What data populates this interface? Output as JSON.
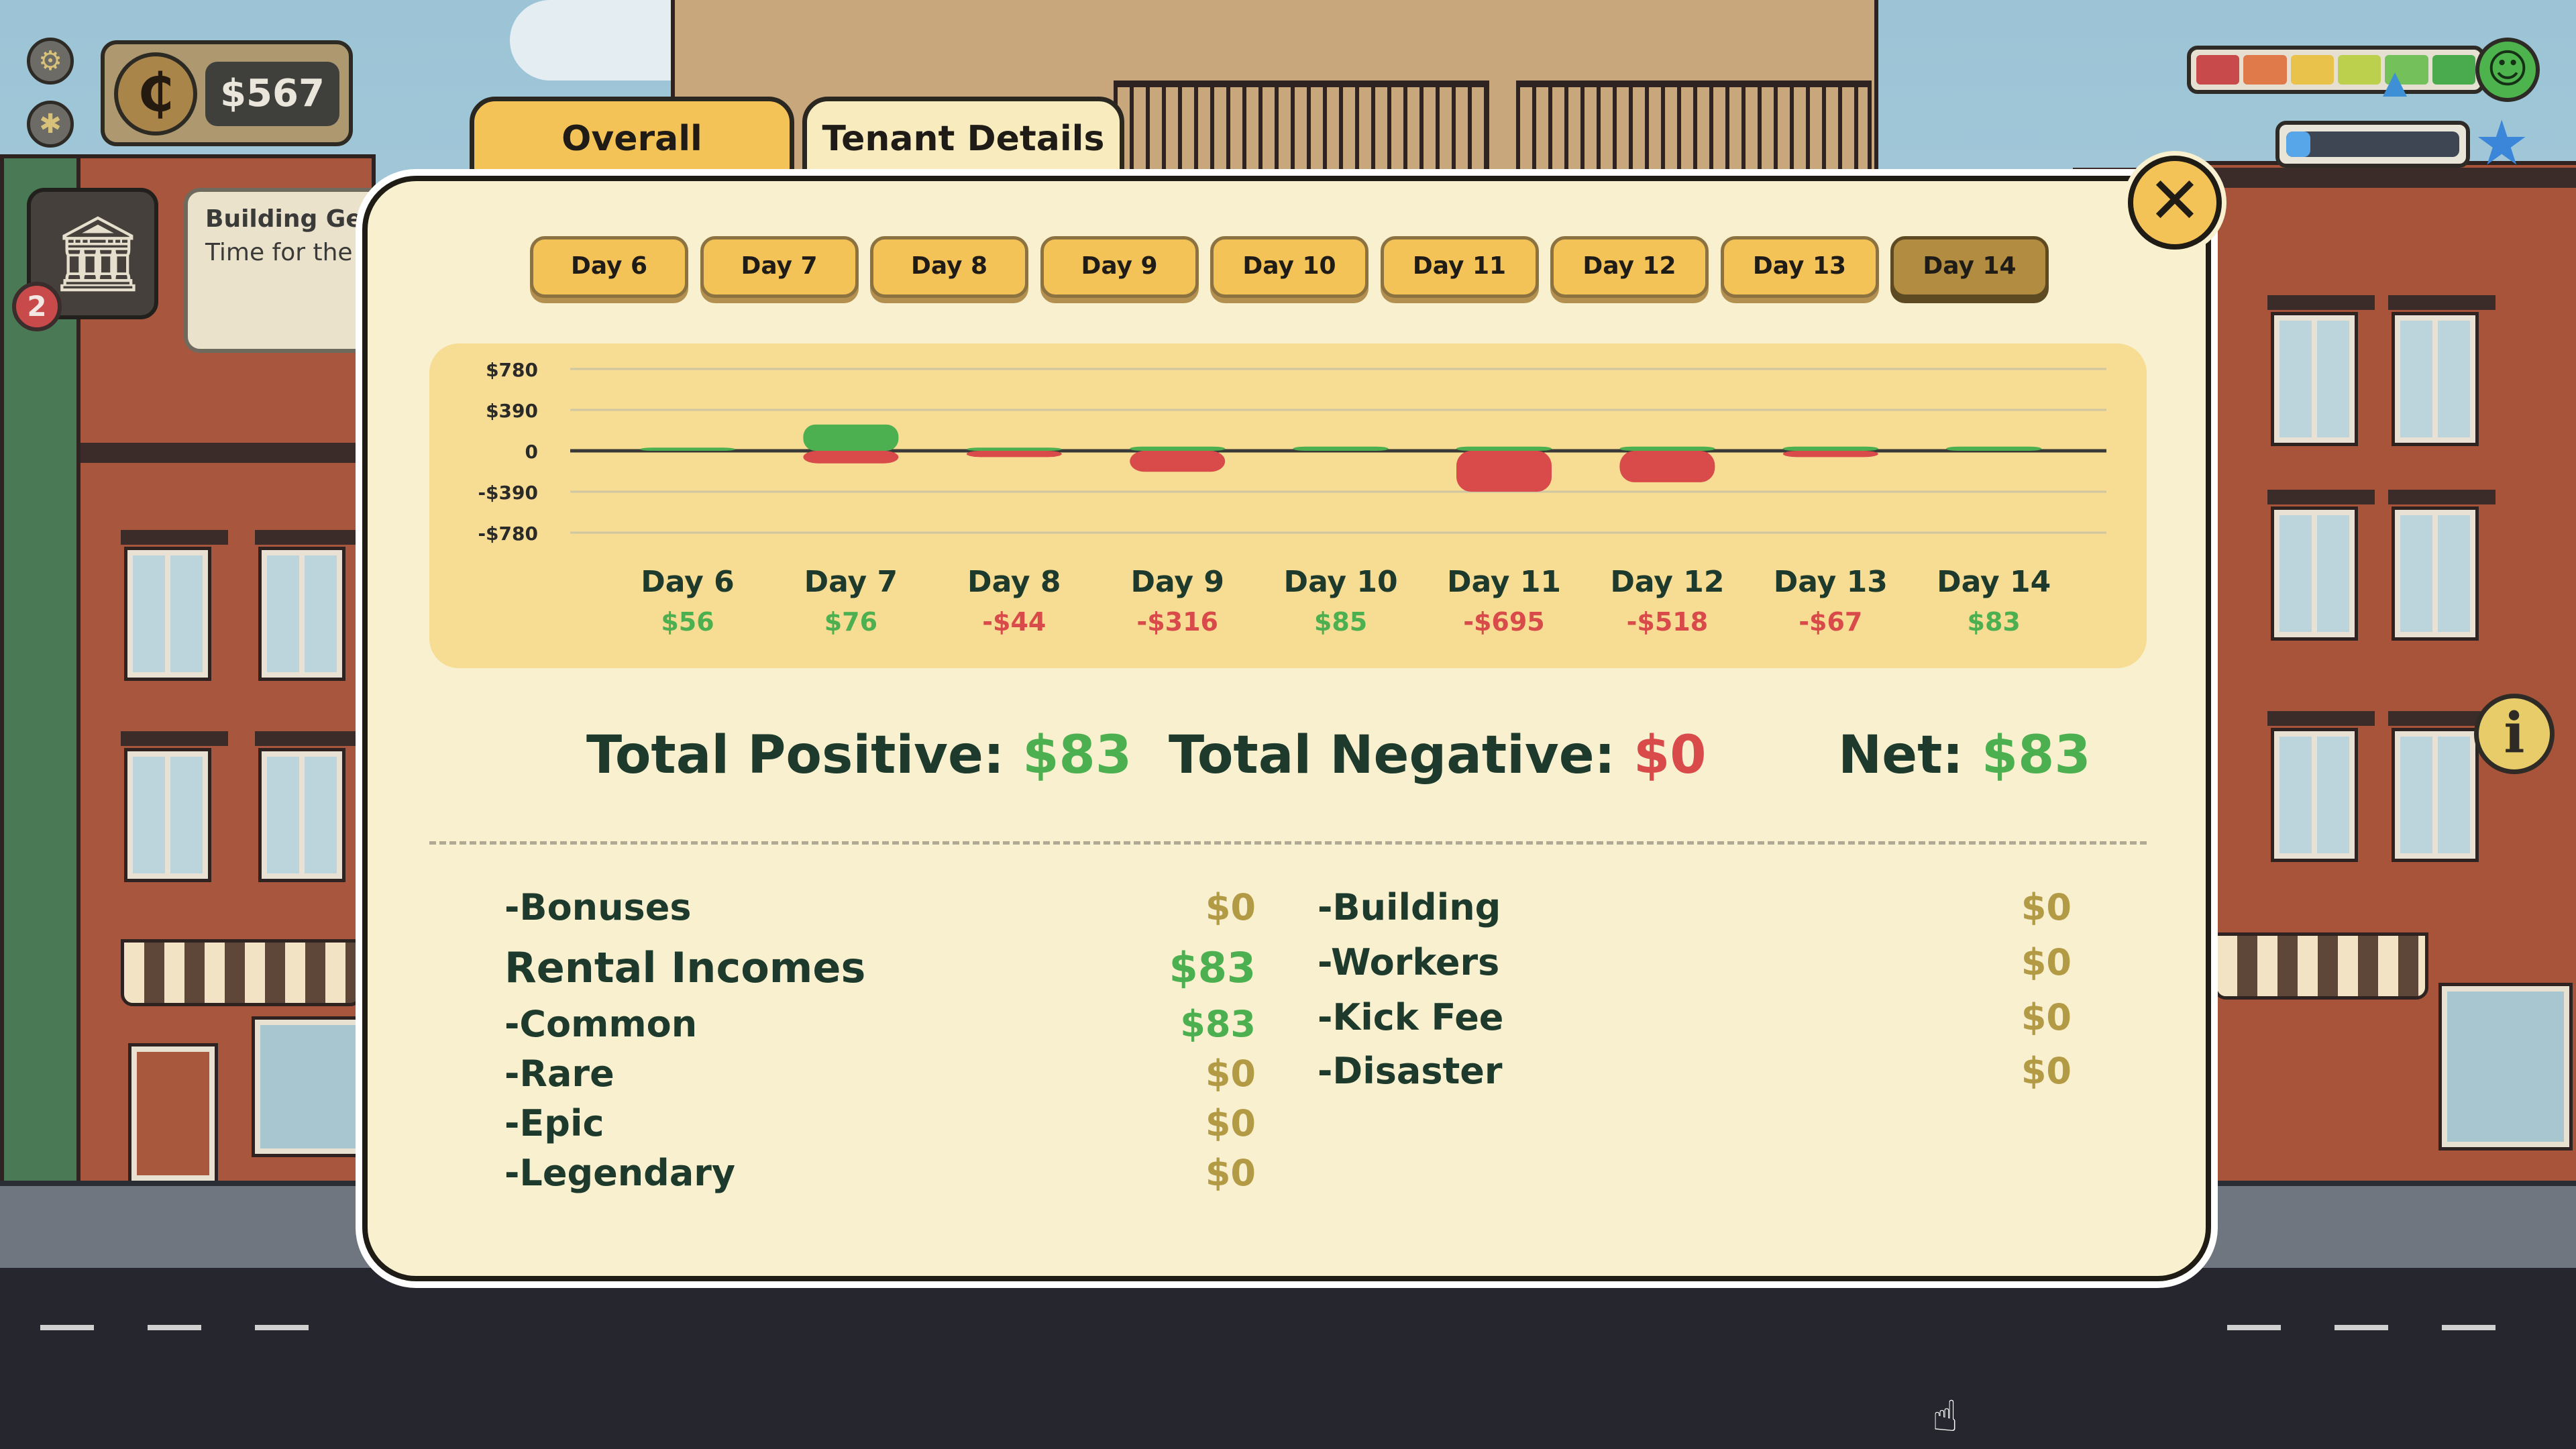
{
  "hud": {
    "money": "$567",
    "coin_symbol": "₵",
    "event": {
      "badge_count": "2",
      "title": "Building General Meeting",
      "description": "Time for the tenant meeting"
    },
    "mood_segments": [
      "#c94a4a",
      "#e07a4a",
      "#e8c24a",
      "#bcd04e",
      "#74c05a",
      "#4aaa4e"
    ],
    "mood_level": 0.71,
    "xp_progress": 0.14
  },
  "tabs": {
    "overall": "Overall",
    "tenant_details": "Tenant Details"
  },
  "days": [
    "Day 6",
    "Day 7",
    "Day 8",
    "Day 9",
    "Day 10",
    "Day 11",
    "Day 12",
    "Day 13",
    "Day 14"
  ],
  "selected_day": "Day 14",
  "chart_data": {
    "type": "bar",
    "categories": [
      "Day 6",
      "Day 7",
      "Day 8",
      "Day 9",
      "Day 10",
      "Day 11",
      "Day 12",
      "Day 13",
      "Day 14"
    ],
    "series": [
      {
        "values": [
          30,
          250,
          30,
          40,
          40,
          40,
          40,
          40,
          40
        ],
        "color": "#4caf50"
      },
      {
        "values": [
          0,
          -120,
          -60,
          -200,
          0,
          -390,
          -300,
          -60,
          0
        ],
        "color": "#d94a4a"
      }
    ],
    "net_labels": [
      "$56",
      "$76",
      "-$44",
      "-$316",
      "$85",
      "-$695",
      "-$518",
      "-$67",
      "$83"
    ],
    "net_values": [
      56,
      76,
      -44,
      -316,
      85,
      -695,
      -518,
      -67,
      83
    ],
    "ytick_labels": [
      "$780",
      "$390",
      "0",
      "-$390",
      "-$780"
    ],
    "yticks": [
      780,
      390,
      0,
      -390,
      -780
    ],
    "ylim": [
      -780,
      780
    ],
    "grid": true
  },
  "totals": {
    "positive_label": "Total Positive: ",
    "positive_value": "$83",
    "negative_label": "Total Negative: ",
    "negative_value": "$0",
    "net_label": "Net: ",
    "net_value": "$83"
  },
  "breakdown": {
    "left": [
      {
        "label": "-Bonuses",
        "value": "$0"
      },
      {
        "label": "Rental Incomes",
        "value": "$83"
      },
      {
        "label": "-Common",
        "value": "$83"
      },
      {
        "label": "-Rare",
        "value": "$0"
      },
      {
        "label": "-Epic",
        "value": "$0"
      },
      {
        "label": "-Legendary",
        "value": "$0"
      }
    ],
    "right": [
      {
        "label": "-Building",
        "value": "$0"
      },
      {
        "label": "-Workers",
        "value": "$0"
      },
      {
        "label": "-Kick Fee",
        "value": "$0"
      },
      {
        "label": "-Disaster",
        "value": "$0"
      }
    ]
  },
  "colors": {
    "positive": "#4caf50",
    "negative": "#d94a4a",
    "zero": "#b39a45",
    "tab_active": "#f4c357",
    "panel": "#f8f0ce"
  }
}
